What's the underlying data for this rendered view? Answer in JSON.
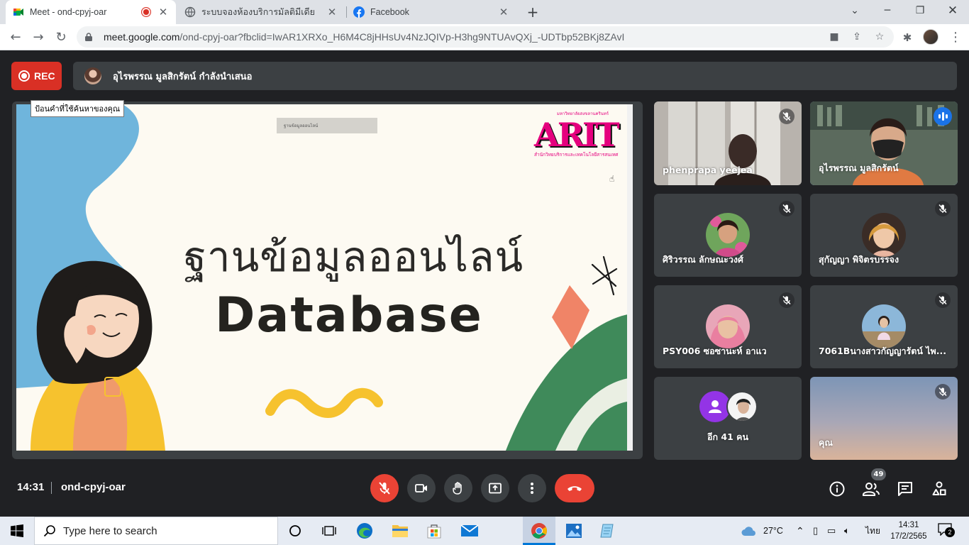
{
  "browser": {
    "tabs": [
      {
        "title": "Meet - ond-cpyj-oar",
        "recording": true
      },
      {
        "title": "ระบบจองห้องบริการมัลติมีเดีย"
      },
      {
        "title": "Facebook"
      }
    ],
    "url_host": "meet.google.com",
    "url_path": "/ond-cpyj-oar?fbclid=IwAR1XRXo_H6M4C8jHHsUv4NzJQIVp-H3hg9NTUAvQXj_-UDTbp52BKj8ZAvI"
  },
  "meet": {
    "rec_label": "REC",
    "presenter_text": "อุไรพรรณ มูลสิกรัตน์ กำลังนำเสนอ",
    "tooltip": "ป้อนคำที่ใช้ค้นหาของคุณ",
    "slide": {
      "title_th": "ฐานข้อมูลออนไลน์",
      "title_en": "Database",
      "logo_text": "ARIT",
      "logo_top": "มหาวิทยาลัยสงขลานครินทร์",
      "logo_sub": "สำนักวิทยบริการและเทคโนโลยีสารสนเทศ",
      "tag_text": "ฐานข้อมูลออนไลน์"
    },
    "participants": [
      {
        "name": "phenprapa yeejea",
        "muted": true
      },
      {
        "name": "อุไรพรรณ มูลสิกรัตน์",
        "speaking": true
      },
      {
        "name": "ศิริวรรณ ลักษณะวงศ์",
        "muted": true
      },
      {
        "name": "สุกัญญา พิจิตรบรรจง",
        "muted": true
      },
      {
        "name": "PSY006 ซอซานะห์ อาแว",
        "muted": true
      },
      {
        "name": "7061Bนางสาวกัญญารัตน์ ไพ...",
        "muted": true
      },
      {
        "name": "อีก 41 คน"
      },
      {
        "name": "คุณ",
        "muted": true
      }
    ],
    "time": "14:31",
    "meeting_code": "ond-cpyj-oar",
    "people_count": "49"
  },
  "taskbar": {
    "search_placeholder": "Type here to search",
    "weather": "27°C",
    "lang": "ไทย",
    "time": "14:31",
    "date": "17/2/2565",
    "notifications": "2"
  },
  "colors": {
    "accent": "#1a73e8",
    "danger": "#ea4335",
    "meet_bg": "#202124",
    "tile_bg": "#3c4043"
  }
}
